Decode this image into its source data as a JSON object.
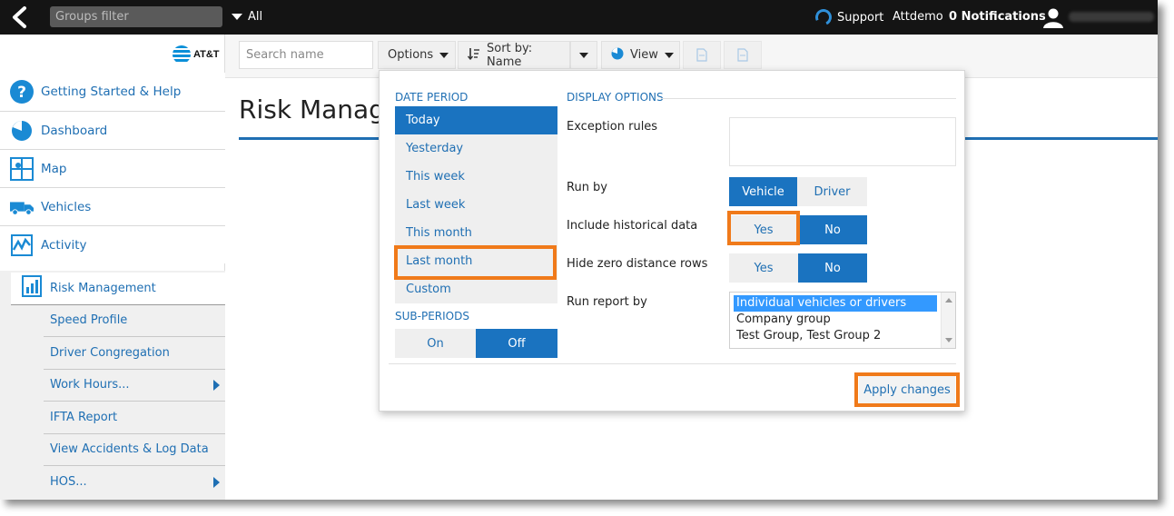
{
  "topbar": {
    "groups_filter_placeholder": "Groups filter",
    "groups_dropdown_label": "All",
    "support_label": "Support",
    "account_name": "Attdemo",
    "notifications_label": "0 Notifications"
  },
  "sidebar": {
    "logo_text": "AT&T",
    "items": [
      {
        "label": "Getting Started & Help",
        "icon": "help-icon"
      },
      {
        "label": "Dashboard",
        "icon": "pie-chart-icon"
      },
      {
        "label": "Map",
        "icon": "map-icon"
      },
      {
        "label": "Vehicles",
        "icon": "truck-icon"
      },
      {
        "label": "Activity",
        "icon": "activity-icon"
      }
    ],
    "subitems": [
      {
        "label": "Risk Management",
        "icon": "report-chart-icon",
        "active": true
      },
      {
        "label": "Speed Profile"
      },
      {
        "label": "Driver Congregation"
      },
      {
        "label": "Work Hours...",
        "has_submenu": true
      },
      {
        "label": "IFTA Report"
      },
      {
        "label": "View Accidents & Log Data"
      },
      {
        "label": "HOS...",
        "has_submenu": true
      }
    ]
  },
  "toolbar": {
    "search_placeholder": "Search name",
    "options_label": "Options",
    "sort_label": "Sort by: Name",
    "view_label": "View"
  },
  "main": {
    "page_title": "Risk Management"
  },
  "options_popup": {
    "date_period_header": "DATE PERIOD",
    "date_periods": [
      "Today",
      "Yesterday",
      "This week",
      "Last week",
      "This month",
      "Last month",
      "Custom"
    ],
    "selected_date_period": "Today",
    "sub_periods_header": "SUB-PERIODS",
    "sub_periods": {
      "on_label": "On",
      "off_label": "Off",
      "selected": "Off"
    },
    "display_options_header": "DISPLAY OPTIONS",
    "exception_rules_label": "Exception rules",
    "run_by": {
      "label": "Run by",
      "options": [
        "Vehicle",
        "Driver"
      ],
      "selected": "Vehicle"
    },
    "include_historical": {
      "label": "Include historical data",
      "options": [
        "Yes",
        "No"
      ],
      "selected": "No"
    },
    "hide_zero_distance": {
      "label": "Hide zero distance rows",
      "options": [
        "Yes",
        "No"
      ],
      "selected": "No"
    },
    "run_report_by": {
      "label": "Run report by",
      "options": [
        "Individual vehicles or drivers",
        "Company group",
        "Test Group, Test Group 2"
      ],
      "selected": "Individual vehicles or drivers"
    },
    "apply_label": "Apply changes"
  },
  "highlight_color": "#f07a1a",
  "accent_color": "#1a73c0"
}
